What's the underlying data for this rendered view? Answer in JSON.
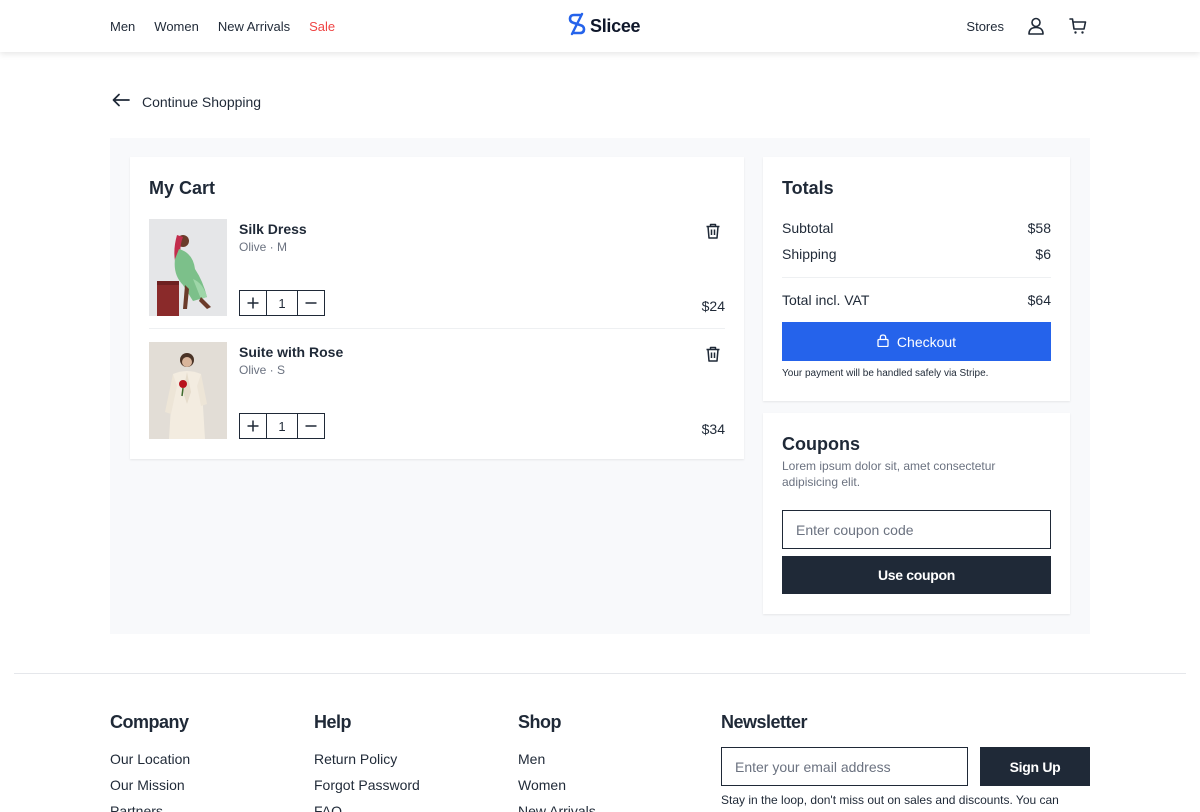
{
  "header": {
    "nav_left": [
      "Men",
      "Women",
      "New Arrivals",
      "Sale"
    ],
    "logo_text": "Slicee",
    "stores_label": "Stores",
    "accent_color": "#2563eb",
    "sale_color": "#ef4444"
  },
  "continue_label": "Continue Shopping",
  "cart": {
    "title": "My Cart",
    "items": [
      {
        "name": "Silk Dress",
        "meta": "Olive · M",
        "qty": "1",
        "price": "$24",
        "image": "model-green-dress"
      },
      {
        "name": "Suite with Rose",
        "meta": "Olive · S",
        "qty": "1",
        "price": "$34",
        "image": "model-cream-suit"
      }
    ]
  },
  "totals": {
    "title": "Totals",
    "subtotal_label": "Subtotal",
    "subtotal_value": "$58",
    "shipping_label": "Shipping",
    "shipping_value": "$6",
    "total_label": "Total incl. VAT",
    "total_value": "$64",
    "checkout_label": "Checkout",
    "payment_note": "Your payment will be handled safely via Stripe."
  },
  "coupons": {
    "title": "Coupons",
    "description": "Lorem ipsum dolor sit, amet consectetur adipisicing elit.",
    "input_placeholder": "Enter coupon code",
    "button_label": "Use coupon"
  },
  "footer": {
    "columns": [
      {
        "title": "Company",
        "links": [
          "Our Location",
          "Our Mission",
          "Partners"
        ]
      },
      {
        "title": "Help",
        "links": [
          "Return Policy",
          "Forgot Password",
          "FAQ"
        ]
      },
      {
        "title": "Shop",
        "links": [
          "Men",
          "Women",
          "New Arrivals"
        ]
      }
    ],
    "newsletter": {
      "title": "Newsletter",
      "input_placeholder": "Enter your email address",
      "button_label": "Sign Up",
      "note": "Stay in the loop, don't miss out on sales and discounts. You can"
    }
  }
}
